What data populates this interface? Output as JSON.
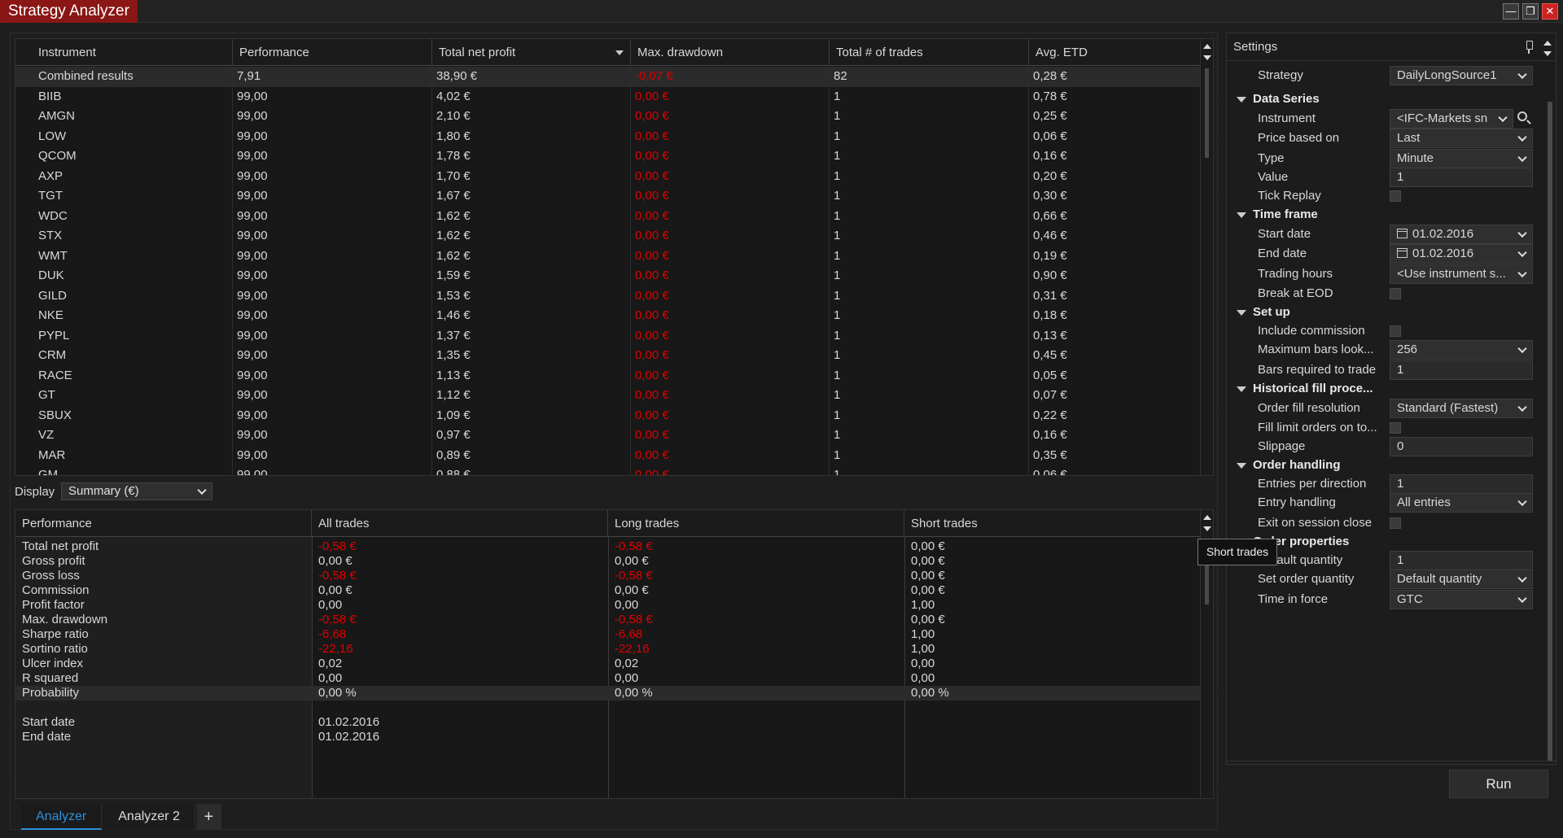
{
  "window": {
    "title": "Strategy Analyzer",
    "controls": [
      "minimize",
      "restore",
      "close"
    ]
  },
  "results_table": {
    "columns": [
      "Instrument",
      "Performance",
      "Total net profit",
      "Max. drawdown",
      "Total # of trades",
      "Avg. ETD"
    ],
    "rows": [
      [
        "Combined results",
        "7,91",
        "38,90 €",
        "-0,07 €",
        "82",
        "0,28 €"
      ],
      [
        "BIIB",
        "99,00",
        "4,02 €",
        "0,00 €",
        "1",
        "0,78 €"
      ],
      [
        "AMGN",
        "99,00",
        "2,10 €",
        "0,00 €",
        "1",
        "0,25 €"
      ],
      [
        "LOW",
        "99,00",
        "1,80 €",
        "0,00 €",
        "1",
        "0,06 €"
      ],
      [
        "QCOM",
        "99,00",
        "1,78 €",
        "0,00 €",
        "1",
        "0,16 €"
      ],
      [
        "AXP",
        "99,00",
        "1,70 €",
        "0,00 €",
        "1",
        "0,20 €"
      ],
      [
        "TGT",
        "99,00",
        "1,67 €",
        "0,00 €",
        "1",
        "0,30 €"
      ],
      [
        "WDC",
        "99,00",
        "1,62 €",
        "0,00 €",
        "1",
        "0,66 €"
      ],
      [
        "STX",
        "99,00",
        "1,62 €",
        "0,00 €",
        "1",
        "0,46 €"
      ],
      [
        "WMT",
        "99,00",
        "1,62 €",
        "0,00 €",
        "1",
        "0,19 €"
      ],
      [
        "DUK",
        "99,00",
        "1,59 €",
        "0,00 €",
        "1",
        "0,90 €"
      ],
      [
        "GILD",
        "99,00",
        "1,53 €",
        "0,00 €",
        "1",
        "0,31 €"
      ],
      [
        "NKE",
        "99,00",
        "1,46 €",
        "0,00 €",
        "1",
        "0,18 €"
      ],
      [
        "PYPL",
        "99,00",
        "1,37 €",
        "0,00 €",
        "1",
        "0,13 €"
      ],
      [
        "CRM",
        "99,00",
        "1,35 €",
        "0,00 €",
        "1",
        "0,45 €"
      ],
      [
        "RACE",
        "99,00",
        "1,13 €",
        "0,00 €",
        "1",
        "0,05 €"
      ],
      [
        "GT",
        "99,00",
        "1,12 €",
        "0,00 €",
        "1",
        "0,07 €"
      ],
      [
        "SBUX",
        "99,00",
        "1,09 €",
        "0,00 €",
        "1",
        "0,22 €"
      ],
      [
        "VZ",
        "99,00",
        "0,97 €",
        "0,00 €",
        "1",
        "0,16 €"
      ],
      [
        "MAR",
        "99,00",
        "0,89 €",
        "0,00 €",
        "1",
        "0,35 €"
      ],
      [
        "GM",
        "99,00",
        "0,88 €",
        "0,00 €",
        "1",
        "0,06 €"
      ]
    ]
  },
  "display": {
    "label": "Display",
    "selected": "Summary (€)"
  },
  "performance_table": {
    "columns": [
      "Performance",
      "All trades",
      "Long trades",
      "Short trades"
    ],
    "rows": [
      [
        "Total net profit",
        "-0,58 €",
        "-0,58 €",
        "0,00 €"
      ],
      [
        "Gross profit",
        "0,00 €",
        "0,00 €",
        "0,00 €"
      ],
      [
        "Gross loss",
        "-0,58 €",
        "-0,58 €",
        "0,00 €"
      ],
      [
        "Commission",
        "0,00 €",
        "0,00 €",
        "0,00 €"
      ],
      [
        "Profit factor",
        "0,00",
        "0,00",
        "1,00"
      ],
      [
        "Max. drawdown",
        "-0,58 €",
        "-0,58 €",
        "0,00 €"
      ],
      [
        "Sharpe ratio",
        "-6,68",
        "-6,68",
        "1,00"
      ],
      [
        "Sortino ratio",
        "-22,16",
        "-22,16",
        "1,00"
      ],
      [
        "Ulcer index",
        "0,02",
        "0,02",
        "0,00"
      ],
      [
        "R squared",
        "0,00",
        "0,00",
        "0,00"
      ],
      [
        "Probability",
        "0,00 %",
        "0,00 %",
        "0,00 %"
      ]
    ],
    "date_rows": [
      [
        "Start date",
        "01.02.2016",
        "",
        ""
      ],
      [
        "End date",
        "01.02.2016",
        "",
        ""
      ]
    ],
    "tooltip": "Short trades"
  },
  "tabs": [
    "Analyzer",
    "Analyzer 2",
    "+"
  ],
  "settings": {
    "title": "Settings",
    "items": [
      {
        "kind": "field",
        "label": "Strategy",
        "value": "DailyLongSource1",
        "control": "dropdown"
      },
      {
        "kind": "category",
        "label": "Data Series"
      },
      {
        "kind": "field",
        "label": "Instrument",
        "value": "<IFC-Markets sn",
        "control": "dropdown-search"
      },
      {
        "kind": "field",
        "label": "Price based on",
        "value": "Last",
        "control": "dropdown"
      },
      {
        "kind": "field",
        "label": "Type",
        "value": "Minute",
        "control": "dropdown"
      },
      {
        "kind": "field",
        "label": "Value",
        "value": "1",
        "control": "input"
      },
      {
        "kind": "field",
        "label": "Tick Replay",
        "value": "",
        "control": "checkbox"
      },
      {
        "kind": "category",
        "label": "Time frame"
      },
      {
        "kind": "field",
        "label": "Start date",
        "value": "01.02.2016",
        "control": "date"
      },
      {
        "kind": "field",
        "label": "End date",
        "value": "01.02.2016",
        "control": "date"
      },
      {
        "kind": "field",
        "label": "Trading hours",
        "value": "<Use instrument s...",
        "control": "dropdown"
      },
      {
        "kind": "field",
        "label": "Break at EOD",
        "value": "",
        "control": "checkbox"
      },
      {
        "kind": "category",
        "label": "Set up"
      },
      {
        "kind": "field",
        "label": "Include commission",
        "value": "",
        "control": "checkbox"
      },
      {
        "kind": "field",
        "label": "Maximum bars look...",
        "value": "256",
        "control": "dropdown"
      },
      {
        "kind": "field",
        "label": "Bars required to trade",
        "value": "1",
        "control": "input"
      },
      {
        "kind": "category",
        "label": "Historical fill proce..."
      },
      {
        "kind": "field",
        "label": "Order fill resolution",
        "value": "Standard (Fastest)",
        "control": "dropdown"
      },
      {
        "kind": "field",
        "label": "Fill limit orders on to...",
        "value": "",
        "control": "checkbox"
      },
      {
        "kind": "field",
        "label": "Slippage",
        "value": "0",
        "control": "input"
      },
      {
        "kind": "category",
        "label": "Order handling"
      },
      {
        "kind": "field",
        "label": "Entries per direction",
        "value": "1",
        "control": "input"
      },
      {
        "kind": "field",
        "label": "Entry handling",
        "value": "All entries",
        "control": "dropdown"
      },
      {
        "kind": "field",
        "label": "Exit on session close",
        "value": "",
        "control": "checkbox"
      },
      {
        "kind": "category",
        "label": "Order properties"
      },
      {
        "kind": "field",
        "label": "Default quantity",
        "value": "1",
        "control": "input"
      },
      {
        "kind": "field",
        "label": "Set order quantity",
        "value": "Default quantity",
        "control": "dropdown"
      },
      {
        "kind": "field",
        "label": "Time in force",
        "value": "GTC",
        "control": "dropdown"
      }
    ],
    "template_link": "template",
    "run_button": "Run"
  },
  "colors": {
    "accent": "#2f8fd8",
    "title_bg": "#8b1616",
    "negative": "#e00000"
  }
}
